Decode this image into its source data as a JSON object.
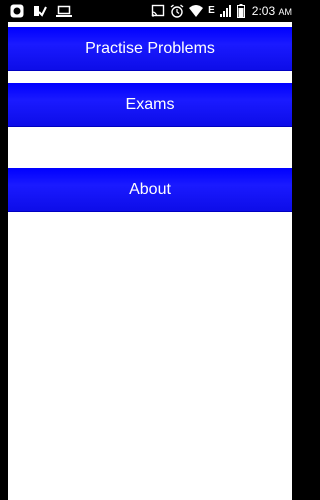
{
  "status_bar": {
    "network_label": "E",
    "time": "2:03",
    "ampm": "AM",
    "icons": [
      "app-icon",
      "check-icon",
      "laptop-icon",
      "cast-icon",
      "alarm-icon",
      "wifi-icon",
      "network-label",
      "signal-icon",
      "battery-icon"
    ]
  },
  "menu": {
    "items": [
      {
        "label": "Practise Problems"
      },
      {
        "label": "Exams"
      },
      {
        "label": "About"
      }
    ]
  },
  "colors": {
    "button_blue": "#0000ff",
    "background": "#ffffff",
    "status_bar": "#000000"
  }
}
